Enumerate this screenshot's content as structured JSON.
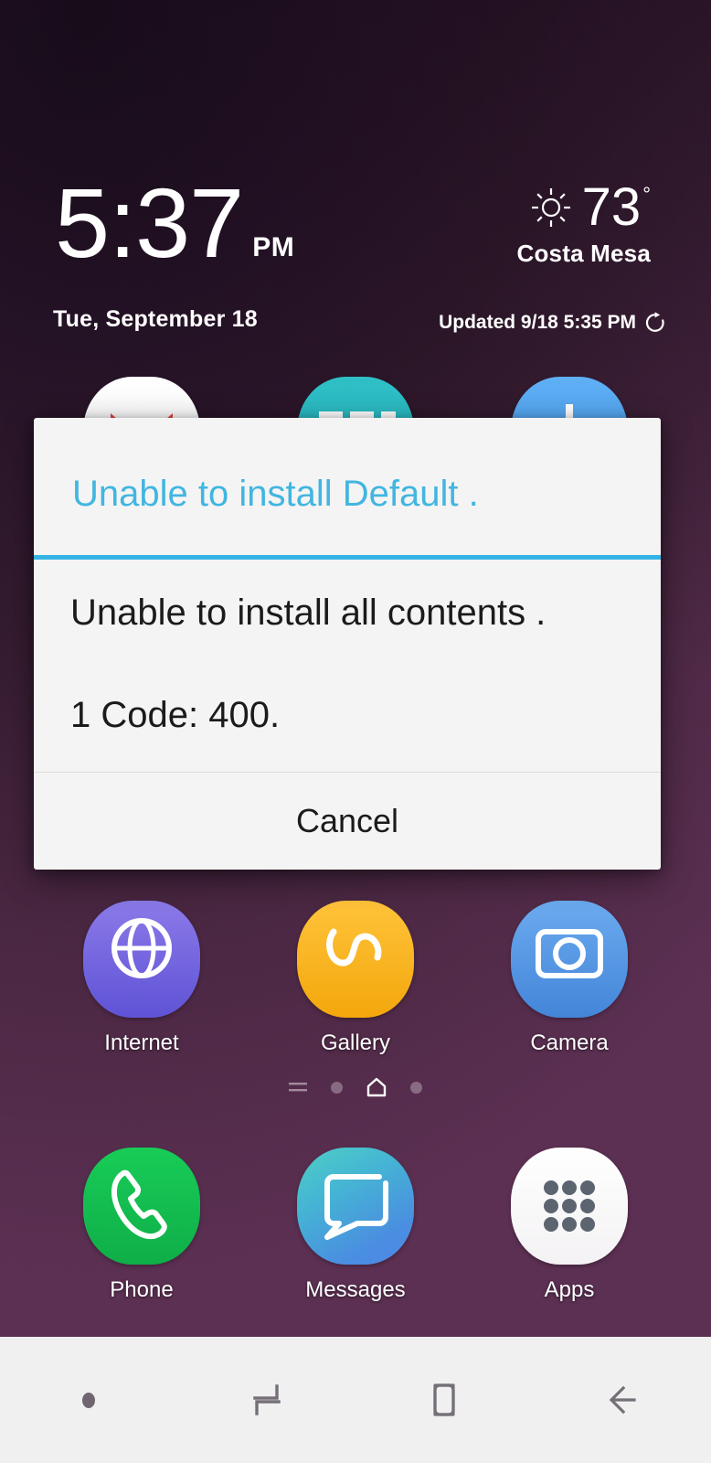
{
  "status_widget": {
    "time": "5:37",
    "ampm": "PM",
    "date": "Tue, September 18",
    "weather": {
      "icon": "sun-icon",
      "temperature": "73",
      "degree_symbol": "°",
      "city": "Costa Mesa",
      "updated": "Updated 9/18 5:35 PM",
      "refresh_icon": "refresh-icon"
    }
  },
  "home_screen": {
    "rows": [
      {
        "apps": [
          {
            "label": "",
            "icon": "white-red-app-icon",
            "color": "#fdfdfd"
          },
          {
            "label": "",
            "icon": "teal-dashes-app-icon",
            "color": "#29b5bd"
          },
          {
            "label": "",
            "icon": "blue-app-icon",
            "color": "#4da2ef"
          }
        ]
      },
      {
        "apps": [
          {
            "label": "",
            "icon": "hidden-app-icon-left",
            "color": "#7b6bd8"
          },
          {
            "label": "",
            "icon": "hidden-app-icon-mid",
            "color": "#f4b223"
          },
          {
            "label": "",
            "icon": "hidden-app-icon-right",
            "color": "#5a9ae8"
          }
        ]
      },
      {
        "apps": [
          {
            "label": "Internet",
            "icon": "internet-icon",
            "color": "#6f63e0"
          },
          {
            "label": "Gallery",
            "icon": "gallery-icon",
            "color": "#f7b318"
          },
          {
            "label": "Camera",
            "icon": "camera-icon",
            "color": "#5a9ae8"
          }
        ]
      }
    ],
    "page_indicator": {
      "items": [
        "lines-icon",
        "dot",
        "home-icon",
        "dot"
      ],
      "active_index": 2
    },
    "dock": [
      {
        "label": "Phone",
        "icon": "phone-icon",
        "color": "#16c052"
      },
      {
        "label": "Messages",
        "icon": "messages-icon",
        "color": "#45b5d4"
      },
      {
        "label": "Apps",
        "icon": "apps-grid-icon",
        "color": "#ffffff"
      }
    ]
  },
  "dialog": {
    "title": "Unable to install Default .",
    "message": "Unable to install all contents .\n\n1 Code: 400.",
    "cancel_label": "Cancel",
    "accent_color": "#35b3e4",
    "title_color": "#41b6e0"
  },
  "navigation_bar": {
    "items": [
      "nav-dot",
      "recents-icon",
      "home-icon",
      "back-icon"
    ]
  }
}
